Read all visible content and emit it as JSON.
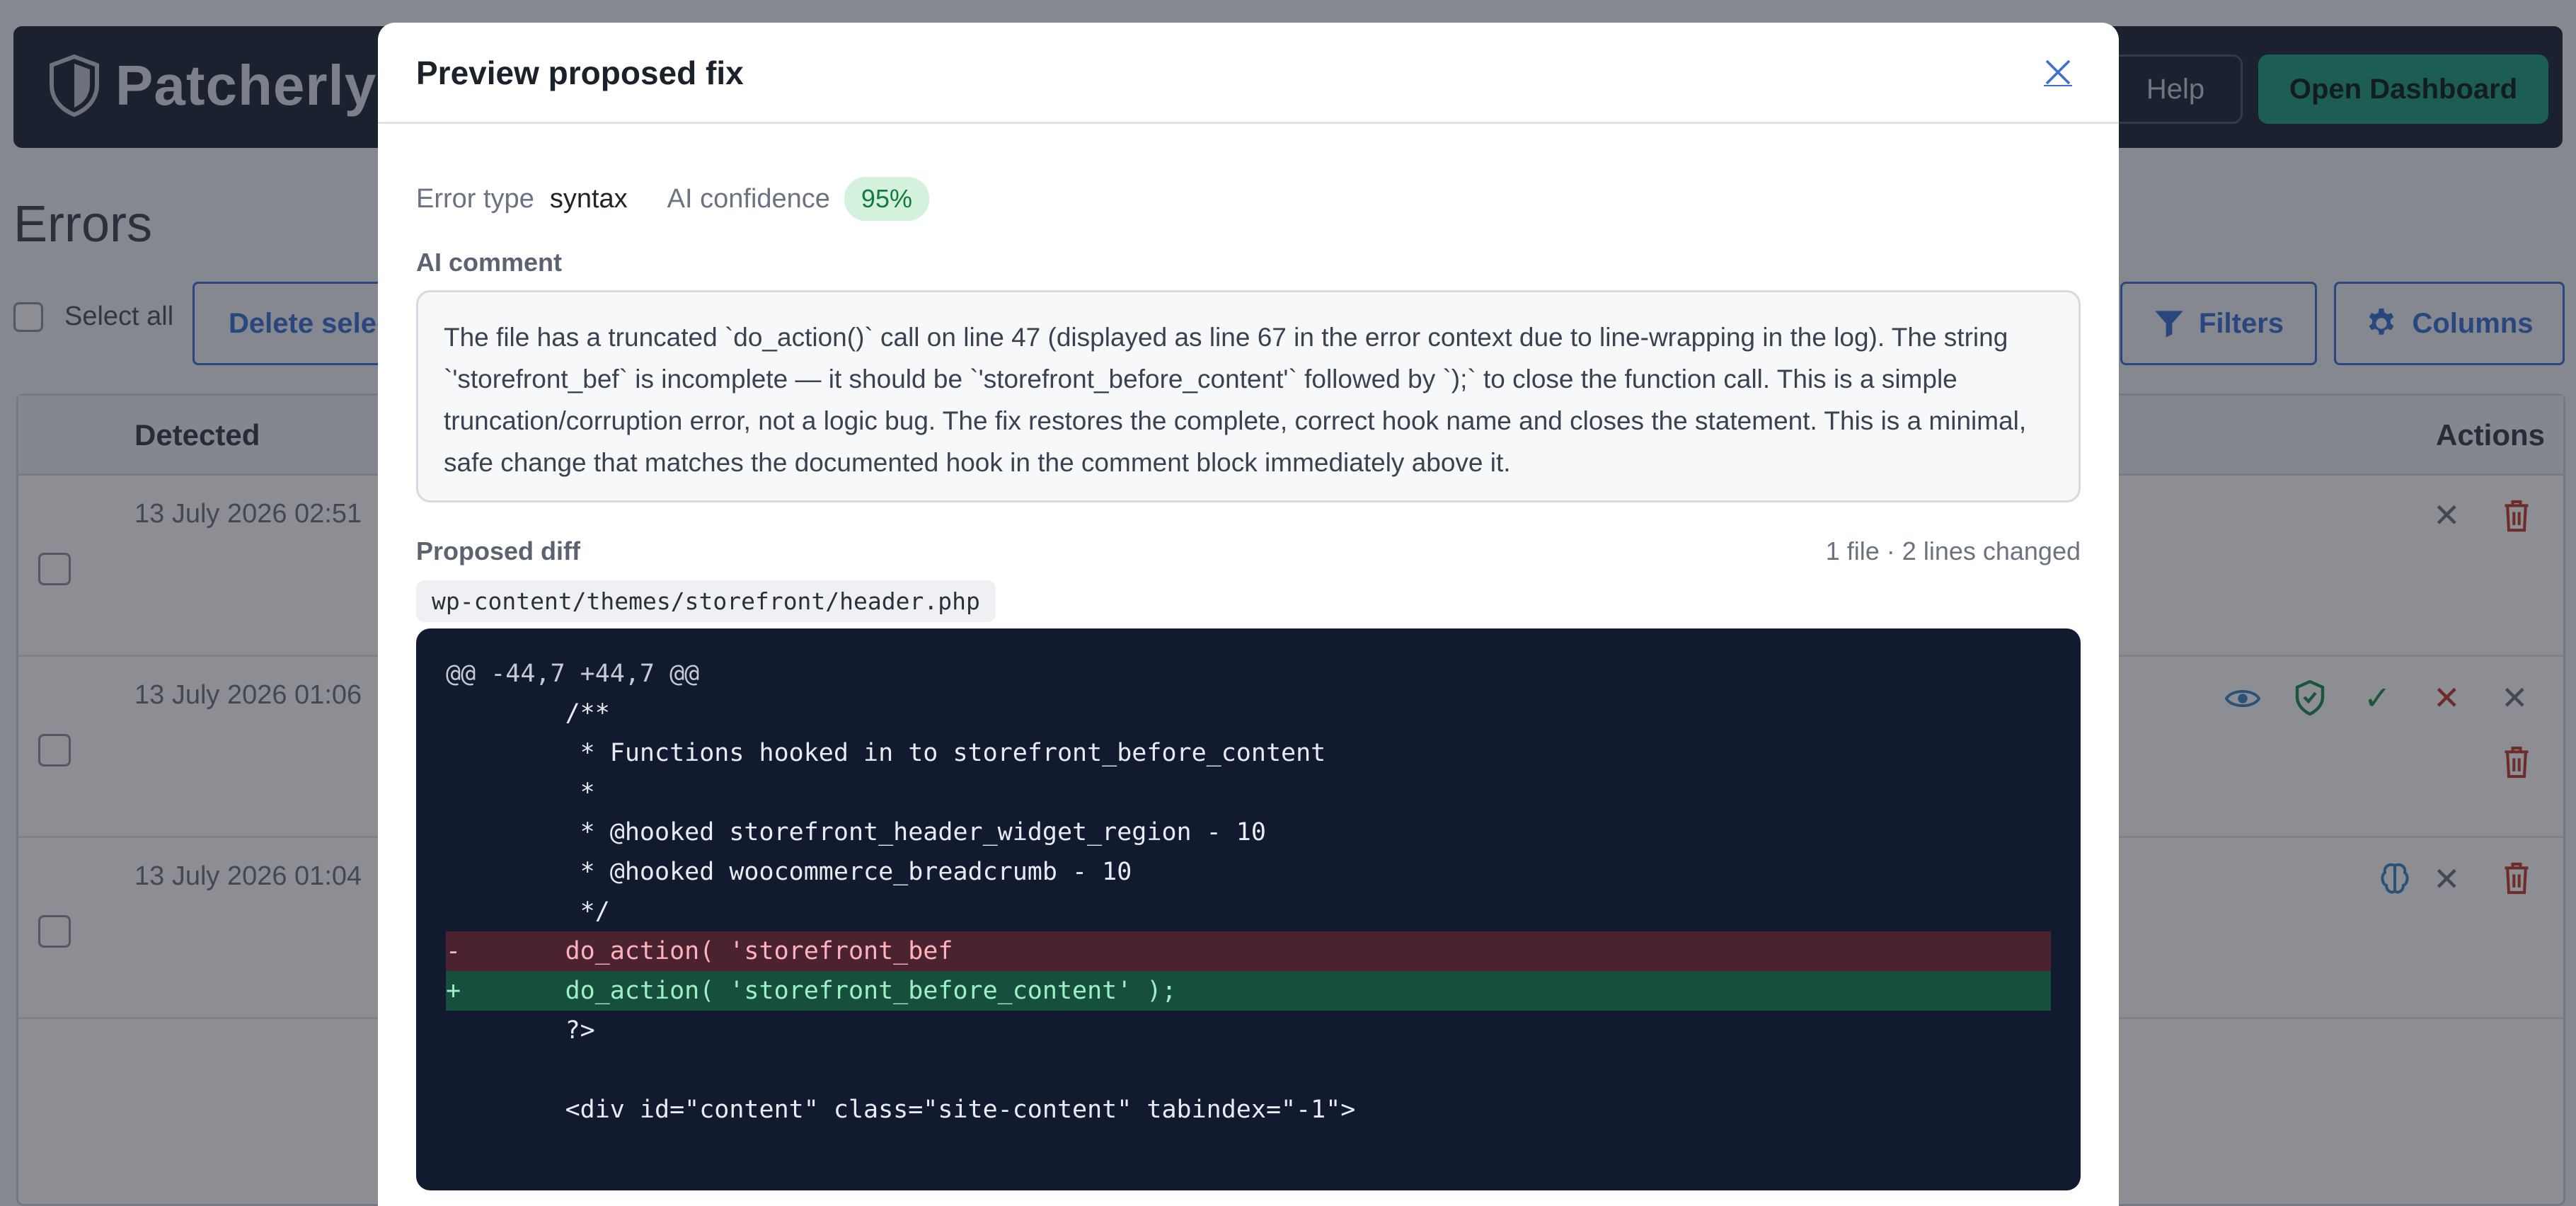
{
  "app": {
    "brand_name": "Patcherly",
    "nav": {
      "help_label": "Help",
      "dashboard_label": "Open Dashboard"
    },
    "page_title": "Errors",
    "toolbar": {
      "select_all_label": "Select all",
      "delete_label": "Delete selected",
      "filters_label": "Filters",
      "columns_label": "Columns"
    },
    "table": {
      "columns": {
        "detected": "Detected",
        "actions": "Actions"
      },
      "rows": [
        {
          "detected": "13 July 2026 02:51"
        },
        {
          "detected": "13 July 2026 01:06"
        },
        {
          "detected": "13 July 2026 01:04"
        }
      ]
    }
  },
  "modal": {
    "title": "Preview proposed fix",
    "error_type_label": "Error type",
    "error_type_value": "syntax",
    "confidence_label": "AI confidence",
    "confidence_value": "95%",
    "comment_label": "AI comment",
    "comment_text": "The file has a truncated `do_action()` call on line 47 (displayed as line 67 in the error context due to line-wrapping in the log). The string `'storefront_bef` is incomplete — it should be `'storefront_before_content'` followed by `);` to close the function call. This is a simple truncation/corruption error, not a logic bug. The fix restores the complete, correct hook name and closes the statement. This is a minimal, safe change that matches the documented hook in the comment block immediately above it.",
    "diff_label": "Proposed diff",
    "diff_summary": "1 file · 2 lines changed",
    "file_path": "wp-content/themes/storefront/header.php",
    "diff_lines": [
      {
        "type": "hunk",
        "text": "@@ -44,7 +44,7 @@"
      },
      {
        "type": "ctx",
        "text": "        /**"
      },
      {
        "type": "ctx",
        "text": "         * Functions hooked in to storefront_before_content"
      },
      {
        "type": "ctx",
        "text": "         *"
      },
      {
        "type": "ctx",
        "text": "         * @hooked storefront_header_widget_region - 10"
      },
      {
        "type": "ctx",
        "text": "         * @hooked woocommerce_breadcrumb - 10"
      },
      {
        "type": "ctx",
        "text": "         */"
      },
      {
        "type": "del",
        "text": "-       do_action( 'storefront_bef"
      },
      {
        "type": "add",
        "text": "+       do_action( 'storefront_before_content' );"
      },
      {
        "type": "ctx",
        "text": "        ?>"
      },
      {
        "type": "ctx",
        "text": ""
      },
      {
        "type": "ctx",
        "text": "        <div id=\"content\" class=\"site-content\" tabindex=\"-1\">"
      }
    ]
  },
  "icons": {
    "brand": "shield-icon",
    "close": "close-icon",
    "filter": "filter-icon",
    "columns": "gear-icon",
    "view": "eye-icon",
    "approve": "shield-check-icon",
    "accept": "check-icon",
    "reject": "x-icon",
    "dismiss": "close-icon",
    "delete": "trash-icon",
    "analyze": "brain-icon"
  },
  "colors": {
    "accent": "#3a6fd4",
    "brand_green": "#1f9e7f",
    "danger": "#c0392b",
    "success": "#1e8f4c",
    "diff_bg": "#111a2e"
  }
}
